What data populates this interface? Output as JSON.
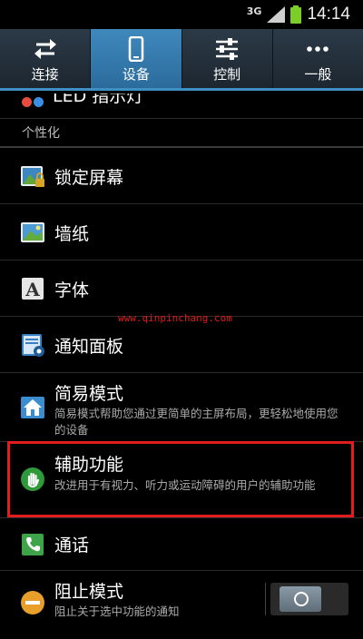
{
  "status_bar": {
    "network": "3G",
    "time": "14:14"
  },
  "tabs": [
    {
      "label": "连接",
      "icon": "swap-arrows-icon",
      "active": false
    },
    {
      "label": "设备",
      "icon": "phone-device-icon",
      "active": true
    },
    {
      "label": "控制",
      "icon": "sliders-icon",
      "active": false
    },
    {
      "label": "一般",
      "icon": "more-dots-icon",
      "active": false
    }
  ],
  "partial_item": {
    "label": "LED 指示灯"
  },
  "section": {
    "title": "个性化"
  },
  "items": [
    {
      "title": "锁定屏幕",
      "icon": "lock-screen-icon"
    },
    {
      "title": "墙纸",
      "icon": "wallpaper-icon"
    },
    {
      "title": "字体",
      "icon": "font-icon"
    },
    {
      "title": "通知面板",
      "icon": "notification-panel-icon"
    },
    {
      "title": "简易模式",
      "desc": "简易模式帮助您通过更简单的主屏布局，更轻松地使用您的设备",
      "icon": "easy-mode-home-icon"
    },
    {
      "title": "辅助功能",
      "desc": "改进用于有视力、听力或运动障碍的用户的辅助功能",
      "icon": "accessibility-hand-icon"
    },
    {
      "title": "通话",
      "icon": "call-phone-icon"
    },
    {
      "title": "阻止模式",
      "desc": "阻止关于选中功能的通知",
      "icon": "block-mode-icon",
      "toggle_on": false
    }
  ],
  "watermark": "www.qinpinchang.com",
  "colors": {
    "accent": "#3e8fc2",
    "highlight": "#e31d1d",
    "battery": "#7ccc2a"
  }
}
